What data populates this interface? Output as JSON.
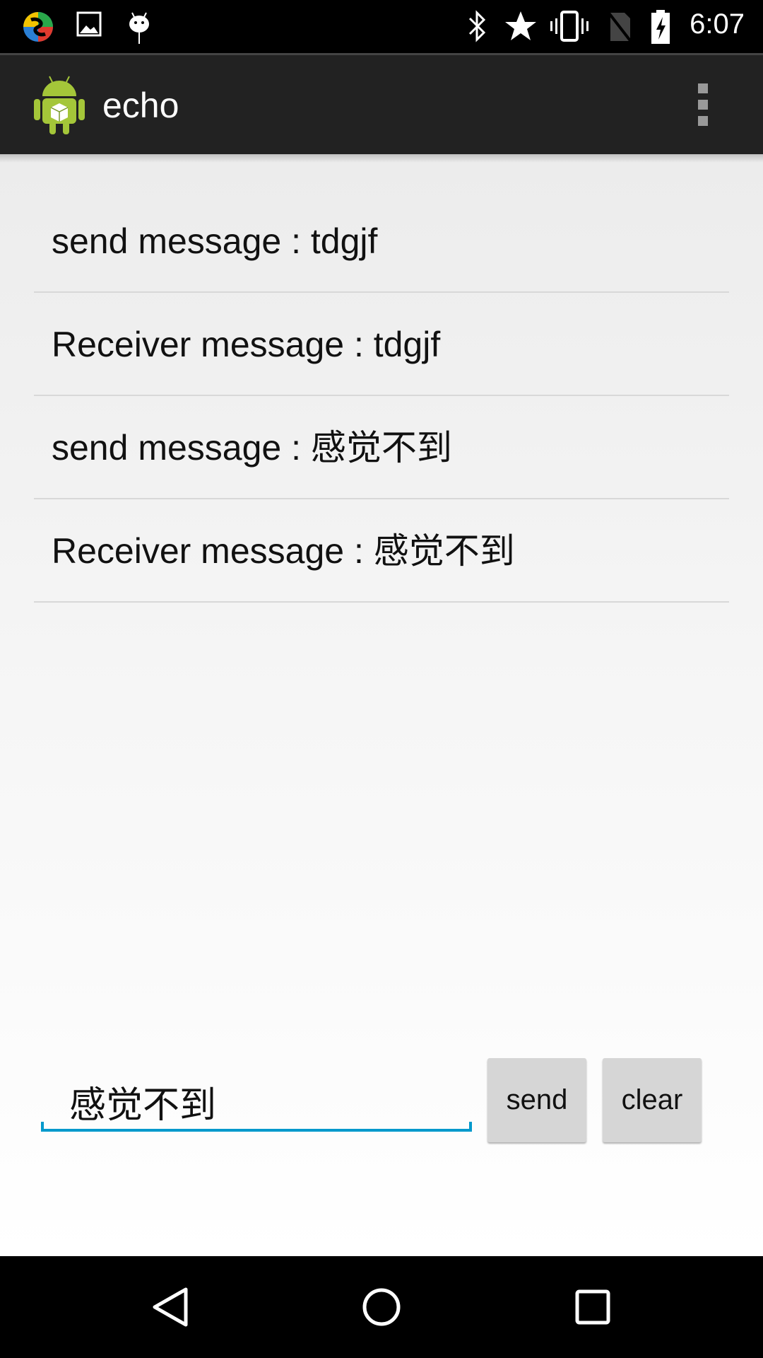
{
  "status_bar": {
    "time": "6:07",
    "icons": [
      "app-notification-icon",
      "image-icon",
      "android-debug-icon",
      "bluetooth-icon",
      "star-icon",
      "vibrate-icon",
      "no-sim-icon",
      "battery-charging-icon"
    ]
  },
  "action_bar": {
    "title": "echo",
    "icon": "android-app-icon",
    "overflow": "overflow-menu-icon"
  },
  "messages": [
    {
      "text": "send message : tdgjf"
    },
    {
      "text": "Receiver message : tdgjf"
    },
    {
      "text": "send message :  感觉不到"
    },
    {
      "text": "Receiver message :  感觉不到"
    }
  ],
  "composer": {
    "input_value": "感觉不到",
    "send_label": "send",
    "clear_label": "clear",
    "accent": "#0099cc"
  },
  "nav_bar": {
    "icons": [
      "back-icon",
      "home-icon",
      "recents-icon"
    ]
  }
}
